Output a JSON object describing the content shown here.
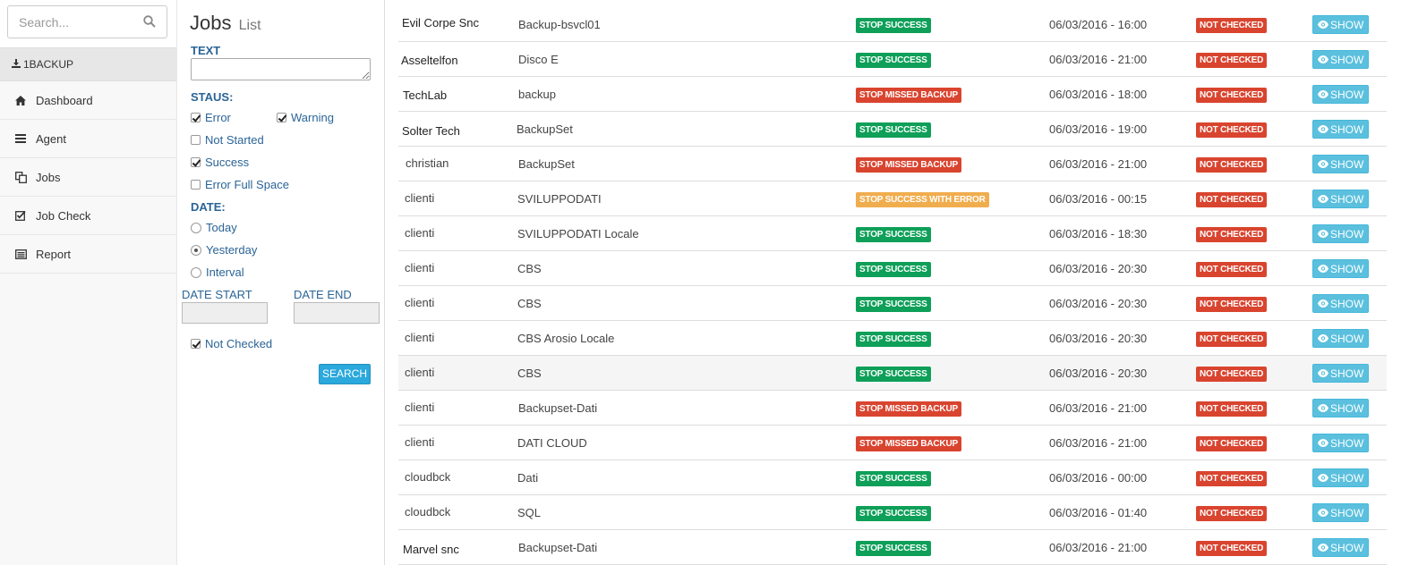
{
  "sidebar": {
    "search_placeholder": "Search...",
    "brand": "1BACKUP",
    "items": [
      {
        "label": "Dashboard",
        "icon": "home-icon"
      },
      {
        "label": "Agent",
        "icon": "bars-icon"
      },
      {
        "label": "Jobs",
        "icon": "copy-icon"
      },
      {
        "label": "Job Check",
        "icon": "check-square-icon"
      },
      {
        "label": "Report",
        "icon": "list-alt-icon"
      }
    ]
  },
  "filter": {
    "title": "Jobs",
    "subtitle": "List",
    "text_label": "TEXT",
    "status_label": "STAUS:",
    "status": {
      "error": {
        "label": "Error",
        "checked": true
      },
      "warning": {
        "label": "Warning",
        "checked": true
      },
      "not_started": {
        "label": "Not Started",
        "checked": false
      },
      "success": {
        "label": "Success",
        "checked": true
      },
      "error_full_space": {
        "label": "Error Full Space",
        "checked": false
      }
    },
    "date_label": "DATE:",
    "date": {
      "today": {
        "label": "Today",
        "selected": false
      },
      "yesterday": {
        "label": "Yesterday",
        "selected": true
      },
      "interval": {
        "label": "Interval",
        "selected": false
      }
    },
    "date_start_label": "DATE START",
    "date_end_label": "DATE END",
    "not_checked": {
      "label": "Not Checked",
      "checked": true
    },
    "search_button": "SEARCH"
  },
  "colors": {
    "success": "#0e9f58",
    "missed": "#d9442f",
    "warning": "#f0ad4e",
    "info": "#5bc0de"
  },
  "jobs": {
    "show_label": "SHOW",
    "rows": [
      {
        "client": "Evil Corpe Snc",
        "job": "Backup-bsvcl01",
        "status": "STOP SUCCESS",
        "kind": "green",
        "date": "06/03/2016 - 16:00",
        "check": "NOT CHECKED"
      },
      {
        "client": "Asseltelfon",
        "job": "Disco E",
        "status": "STOP SUCCESS",
        "kind": "green",
        "date": "06/03/2016 - 21:00",
        "check": "NOT CHECKED"
      },
      {
        "client": "TechLab",
        "job": "backup",
        "status": "STOP MISSED BACKUP",
        "kind": "red",
        "date": "06/03/2016 - 18:00",
        "check": "NOT CHECKED"
      },
      {
        "client": "Solter Tech",
        "job": "BackupSet",
        "status": "STOP SUCCESS",
        "kind": "green",
        "date": "06/03/2016 - 19:00",
        "check": "NOT CHECKED"
      },
      {
        "client": "christian",
        "job": "BackupSet",
        "status": "STOP MISSED BACKUP",
        "kind": "red",
        "date": "06/03/2016 - 21:00",
        "check": "NOT CHECKED"
      },
      {
        "client": "clienti",
        "job": "SVILUPPODATI",
        "status": "STOP SUCCESS WITH ERROR",
        "kind": "orange",
        "date": "06/03/2016 - 00:15",
        "check": "NOT CHECKED"
      },
      {
        "client": "clienti",
        "job": "SVILUPPODATI Locale",
        "status": "STOP SUCCESS",
        "kind": "green",
        "date": "06/03/2016 - 18:30",
        "check": "NOT CHECKED"
      },
      {
        "client": "clienti",
        "job": "CBS",
        "status": "STOP SUCCESS",
        "kind": "green",
        "date": "06/03/2016 - 20:30",
        "check": "NOT CHECKED"
      },
      {
        "client": "clienti",
        "job": "CBS",
        "status": "STOP SUCCESS",
        "kind": "green",
        "date": "06/03/2016 - 20:30",
        "check": "NOT CHECKED"
      },
      {
        "client": "clienti",
        "job": "CBS Arosio Locale",
        "status": "STOP SUCCESS",
        "kind": "green",
        "date": "06/03/2016 - 20:30",
        "check": "NOT CHECKED"
      },
      {
        "client": "clienti",
        "job": "CBS",
        "status": "STOP SUCCESS",
        "kind": "green",
        "date": "06/03/2016 - 20:30",
        "check": "NOT CHECKED",
        "highlight": true
      },
      {
        "client": "clienti",
        "job": "Backupset-Dati",
        "status": "STOP MISSED BACKUP",
        "kind": "red",
        "date": "06/03/2016 - 21:00",
        "check": "NOT CHECKED"
      },
      {
        "client": "clienti",
        "job": "DATI CLOUD",
        "status": "STOP MISSED BACKUP",
        "kind": "red",
        "date": "06/03/2016 - 21:00",
        "check": "NOT CHECKED"
      },
      {
        "client": "cloudbck",
        "job": "Dati",
        "status": "STOP SUCCESS",
        "kind": "green",
        "date": "06/03/2016 - 00:00",
        "check": "NOT CHECKED"
      },
      {
        "client": "cloudbck",
        "job": "SQL",
        "status": "STOP SUCCESS",
        "kind": "green",
        "date": "06/03/2016 - 01:40",
        "check": "NOT CHECKED"
      },
      {
        "client": "Marvel snc",
        "job": "Backupset-Dati",
        "status": "STOP SUCCESS",
        "kind": "green",
        "date": "06/03/2016 - 21:00",
        "check": "NOT CHECKED"
      }
    ]
  }
}
